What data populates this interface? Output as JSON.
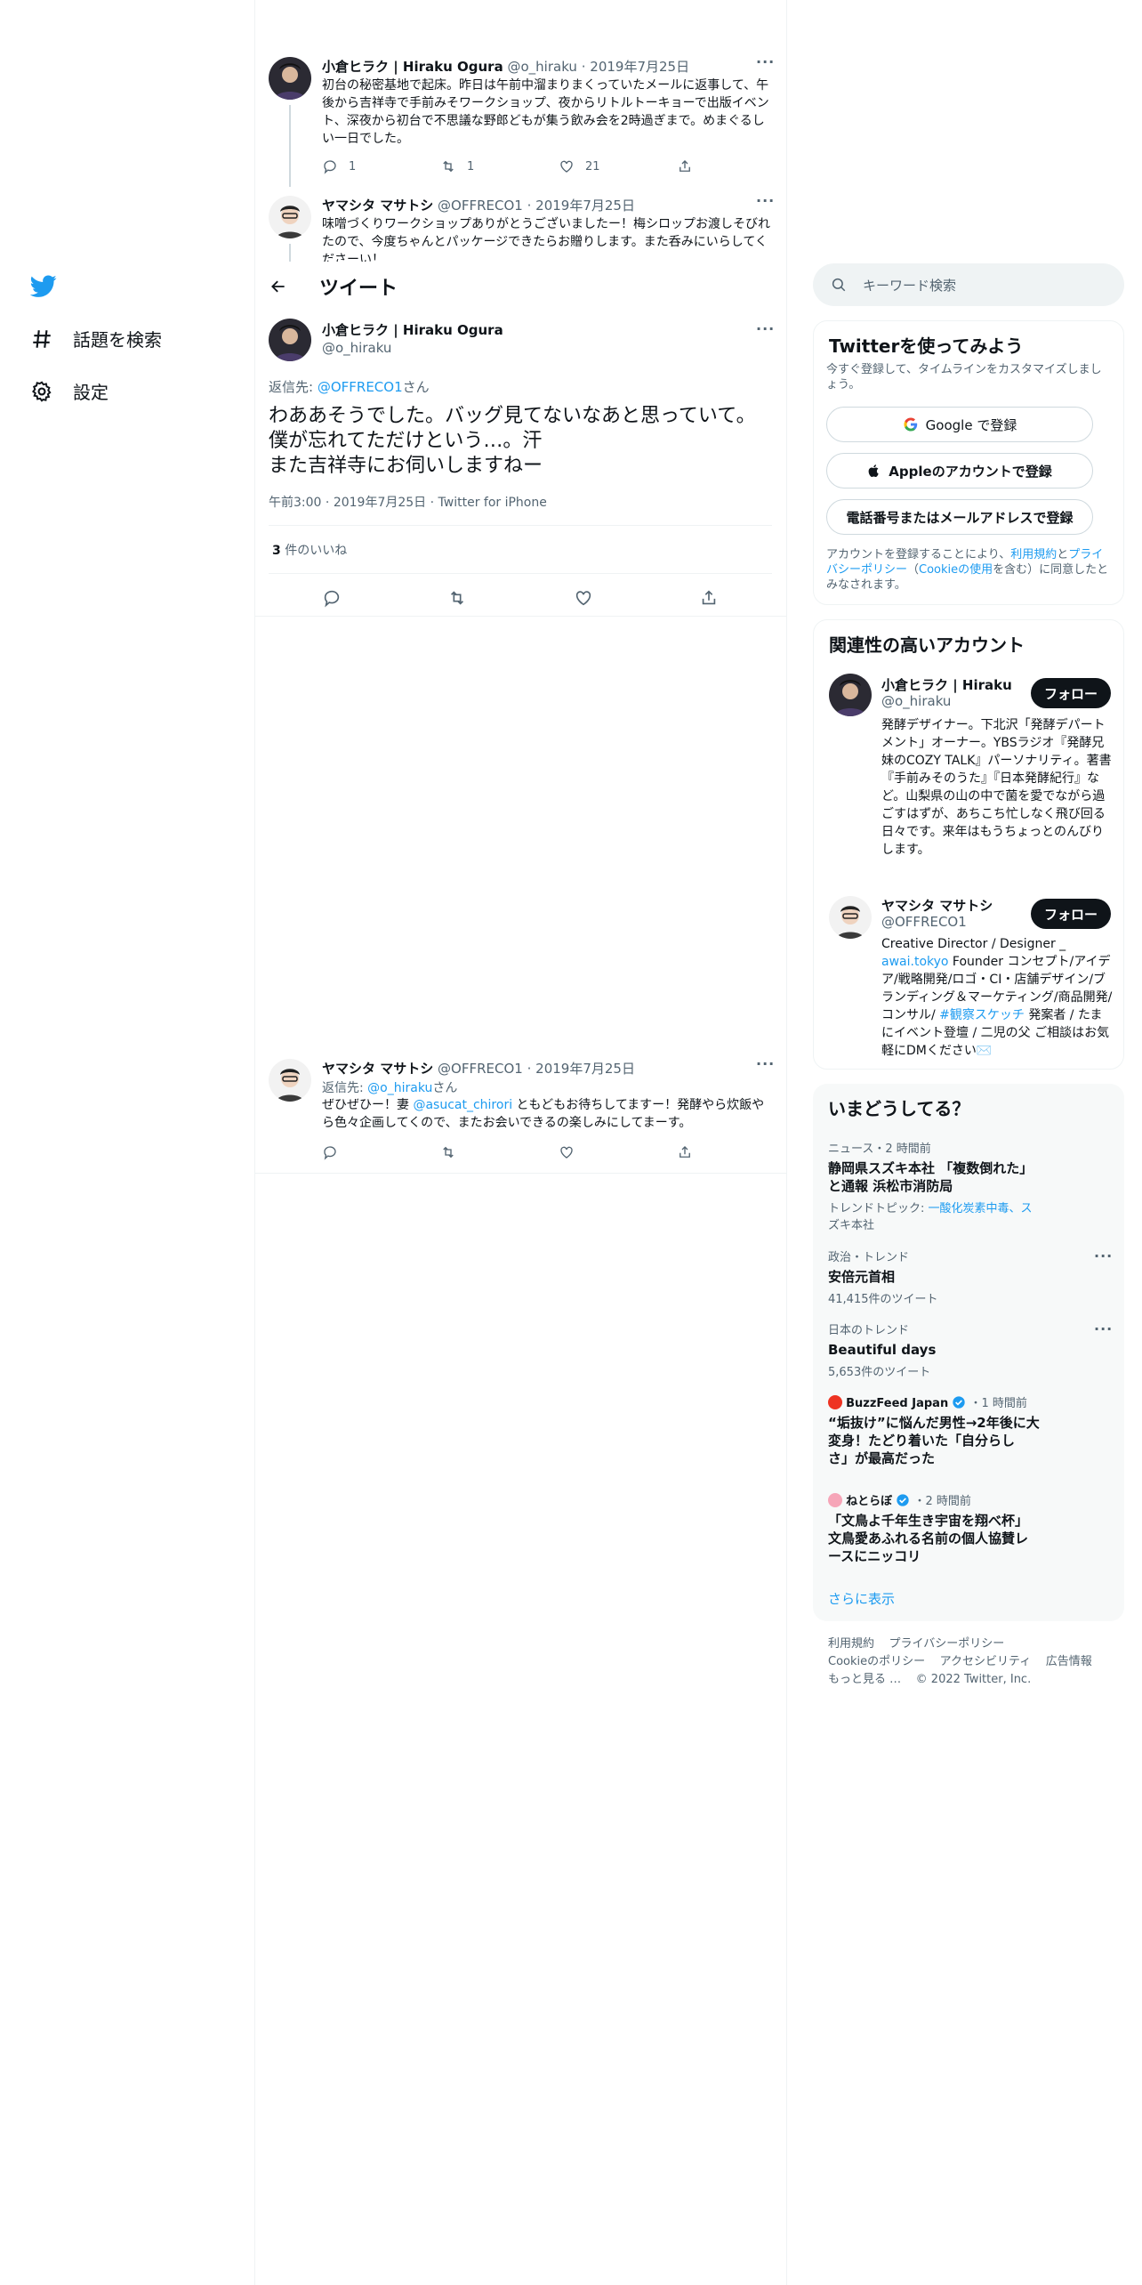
{
  "nav": {
    "explore_label": "話題を検索",
    "settings_label": "設定"
  },
  "header": {
    "title": "ツイート"
  },
  "tweets": {
    "t1": {
      "name": "小倉ヒラク | Hiraku Ogura",
      "handle": "@o_hiraku",
      "date": "2019年7月25日",
      "text": "初台の秘密基地で起床。昨日は午前中溜まりまくっていたメールに返事して、午後から吉祥寺で手前みそワークショップ、夜からリトルトーキョーで出版イベント、深夜から初台で不思議な野郎どもが集う飲み会を2時過ぎまで。めまぐるしい一日でした。",
      "replies": "1",
      "retweets": "1",
      "likes": "21"
    },
    "t2": {
      "name": "ヤマシタ マサトシ",
      "handle": "@OFFRECO1",
      "date": "2019年7月25日",
      "text": "味噌づくりワークショップありがとうございましたー！梅シロップお渡しそびれたので、今度ちゃんとパッケージできたらお贈りします。また呑みにいらしてくださーい！"
    },
    "main": {
      "name": "小倉ヒラク | Hiraku Ogura",
      "handle": "@o_hiraku",
      "reply_prefix": "返信先: ",
      "reply_to": "@OFFRECO1",
      "reply_suffix": "さん",
      "text_line1": "わああそうでした。バッグ見てないなあと思っていて。僕が忘れてただけという…。汗",
      "text_line2": "また吉祥寺にお伺いしますねー",
      "time": "午前3:00",
      "date": "2019年7月25日",
      "source": "Twitter for iPhone",
      "likes_count": "3",
      "likes_label": " 件のいいね"
    },
    "t3": {
      "name": "ヤマシタ マサトシ",
      "handle": "@OFFRECO1",
      "date": "2019年7月25日",
      "reply_prefix": "返信先: ",
      "reply_to": "@o_hiraku",
      "reply_suffix": "さん",
      "text_a": "ぜひぜひー！妻 ",
      "mention": "@asucat_chirori",
      "text_b": " ともどもお待ちしてますー！発酵やら炊飯やら色々企画してくので、またお会いできるの楽しみにしてまーす。"
    }
  },
  "sidebar": {
    "search_placeholder": "キーワード検索",
    "signup": {
      "title": "Twitterを使ってみよう",
      "subtitle": "今すぐ登録して、タイムラインをカスタマイズしましょう。",
      "google_btn": "Google で登録",
      "apple_btn": "Appleのアカウントで登録",
      "phone_btn": "電話番号またはメールアドレスで登録",
      "legal_a": "アカウントを登録することにより、",
      "legal_terms": "利用規約",
      "legal_b": "と",
      "legal_privacy": "プライバシーポリシー",
      "legal_c": "（",
      "legal_cookie": "Cookieの使用",
      "legal_d": "を含む）に同意したとみなされます。"
    },
    "related": {
      "title": "関連性の高いアカウント",
      "follow_label": "フォロー",
      "accounts": [
        {
          "name": "小倉ヒラク | Hiraku ...",
          "handle": "@o_hiraku",
          "bio": "発酵デザイナー。下北沢「発酵デパートメント」オーナー。YBSラジオ『発酵兄妹のCOZY TALK』パーソナリティ。著書『手前みそのうた』『日本発酵紀行』など。山梨県の山の中で菌を愛でながら過ごすはずが、あちこち忙しなく飛び回る日々です。来年はもうちょっとのんびりします。"
        },
        {
          "name": "ヤマシタ マサトシ",
          "handle": "@OFFRECO1",
          "bio_a": "Creative Director / Designer _ ",
          "bio_link": "awai.tokyo",
          "bio_b": " Founder コンセプト/アイデア/戦略開発/ロゴ・CI・店舗デザイン/ブランディング＆マーケティング/商品開発/コンサル/ ",
          "bio_tag": "#観察スケッチ",
          "bio_c": " 発案者 / たまにイベント登壇 / 二児の父 ご相談はお気軽にDMください✉️"
        }
      ]
    },
    "trends": {
      "title": "いまどうしてる？",
      "items": [
        {
          "meta": "ニュース・2 時間前",
          "title_l1": "静岡県スズキ本社 「複数倒れた」",
          "title_l2": "と通報 浜松市消防局",
          "topic_label": "トレンドトピック: ",
          "topic_l1": "一酸化炭素中毒、ス",
          "topic_l2": "ズキ本社"
        },
        {
          "meta": "政治・トレンド",
          "title": "安倍元首相",
          "count": "41,415件のツイート"
        },
        {
          "meta": "日本のトレンド",
          "title": "Beautiful days",
          "count": "5,653件のツイート"
        },
        {
          "source": "BuzzFeed Japan",
          "time": "・1 時間前",
          "title_l1": "“垢抜け”に悩んだ男性→2年後に大",
          "title_l2": "変身！たどり着いた「自分らし",
          "title_l3": "さ」が最高だった"
        },
        {
          "source": "ねとらぼ",
          "time": "・2 時間前",
          "title_l1": "「文鳥よ千年生き宇宙を翔べ杯」",
          "title_l2": "文鳥愛あふれる名前の個人協賛レ",
          "title_l3": "ースにニッコリ"
        }
      ],
      "show_more": "さらに表示"
    },
    "footer": {
      "terms": "利用規約",
      "privacy": "プライバシーポリシー",
      "cookie": "Cookieのポリシー",
      "accessibility": "アクセシビリティ",
      "ads": "広告情報",
      "more": "もっと見る …",
      "copyright": "© 2022 Twitter, Inc."
    }
  },
  "colors": {
    "accent": "#1d9bf0",
    "text": "#0f1419",
    "muted": "#536471",
    "border": "#eff3f4"
  }
}
